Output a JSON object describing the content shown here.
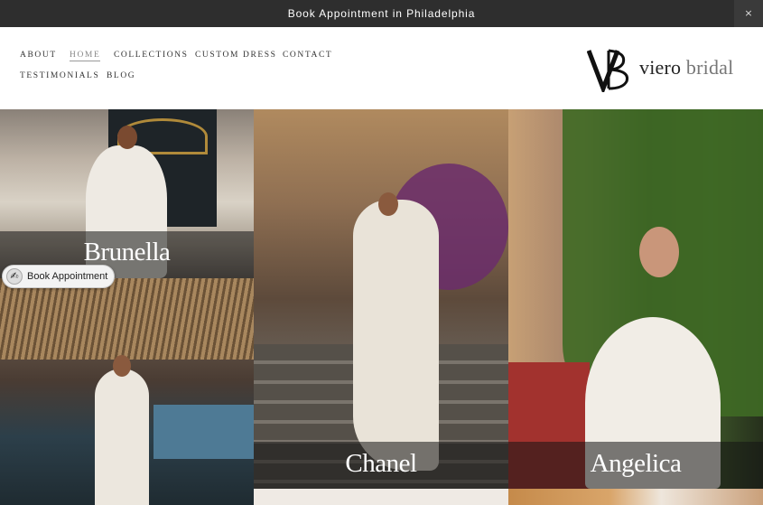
{
  "announcement": {
    "text": "Book Appointment in Philadelphia",
    "close_icon": "×"
  },
  "nav": {
    "items": [
      {
        "label": "ABOUT"
      },
      {
        "label": "HOME"
      },
      {
        "label": "COLLECTIONS"
      },
      {
        "label": "CUSTOM DRESS"
      },
      {
        "label": "CONTACT"
      },
      {
        "label": "TESTIMONIALS"
      },
      {
        "label": "BLOG"
      }
    ],
    "active": "HOME"
  },
  "logo": {
    "monogram": "VB",
    "word1": "viero",
    "word2": "bridal"
  },
  "collections": [
    {
      "name": "Brunella"
    },
    {
      "name": "Chanel"
    },
    {
      "name": "Angelica"
    }
  ],
  "book_widget": {
    "label": "Book Appointment",
    "icon": "calendar-hand-icon"
  }
}
